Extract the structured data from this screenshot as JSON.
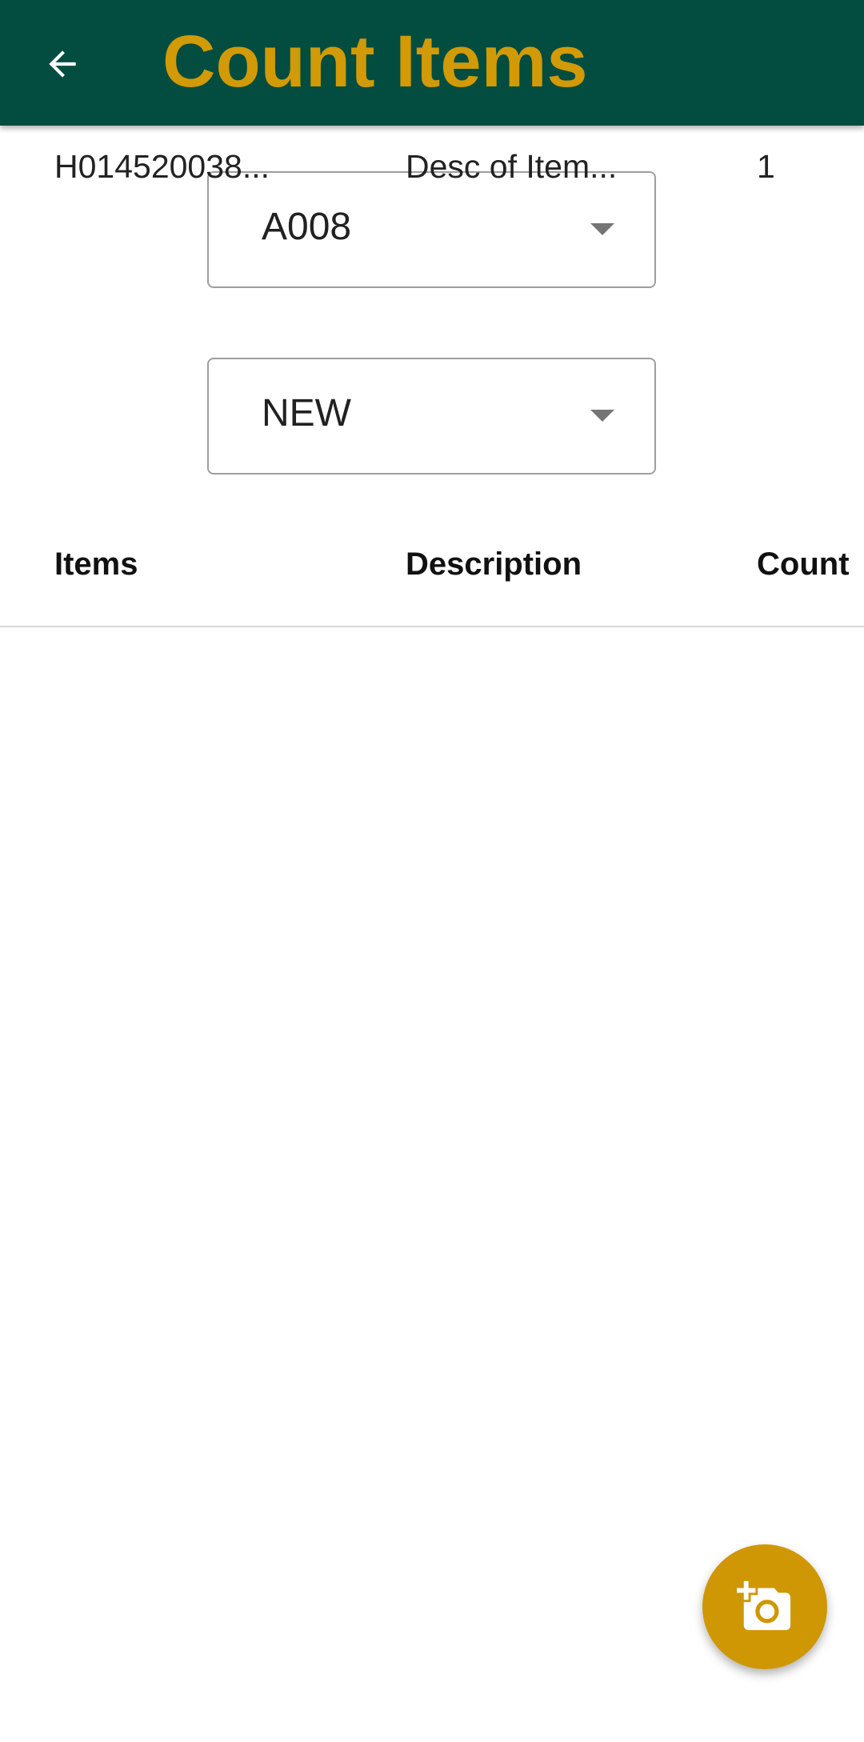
{
  "header": {
    "title": "Count Items",
    "back_icon": "arrow-back-icon"
  },
  "filters": {
    "location": {
      "selected": "A008"
    },
    "status": {
      "selected": "NEW"
    }
  },
  "table": {
    "columns": [
      "Items",
      "Description",
      "Count"
    ],
    "rows": [
      {
        "item": "H014520038...",
        "description": "Desc of Item...",
        "count": "1"
      }
    ]
  },
  "fab": {
    "icon": "add-a-photo-icon"
  },
  "colors": {
    "appbar": "#024d40",
    "accent": "#d19a06",
    "fab": "#cf9703"
  }
}
